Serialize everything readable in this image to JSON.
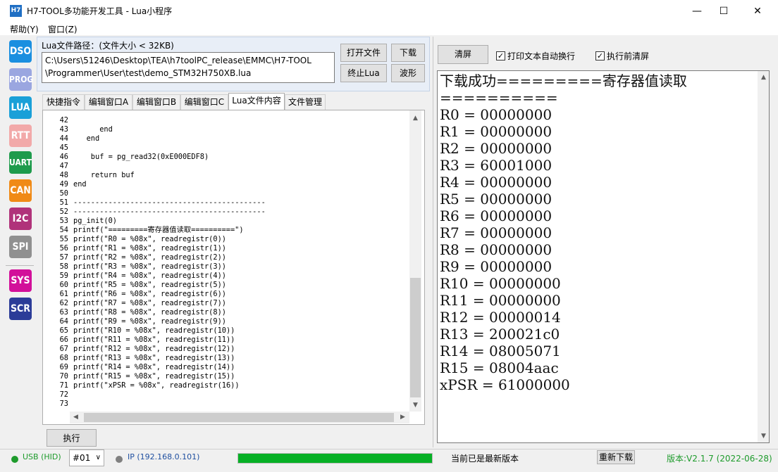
{
  "window": {
    "title": "H7-TOOL多功能开发工具 - Lua小程序",
    "icon_text": "H7"
  },
  "menu": [
    "帮助(Y)",
    "窗口(Z)"
  ],
  "tools": [
    {
      "label": "DSO",
      "color": "#1a8fe0"
    },
    {
      "label": "PROG",
      "color": "#9aa6e0"
    },
    {
      "label": "LUA",
      "color": "#1aa0d8"
    },
    {
      "label": "RTT",
      "color": "#f2a9a9"
    },
    {
      "label": "UART",
      "color": "#1e9b4c"
    },
    {
      "label": "CAN",
      "color": "#f08a16"
    },
    {
      "label": "I2C",
      "color": "#b0327a"
    },
    {
      "label": "SPI",
      "color": "#909090"
    },
    {
      "label": "SYS",
      "color": "#d2109a"
    },
    {
      "label": "SCR",
      "color": "#2b3c98"
    }
  ],
  "lua": {
    "path_label": "Lua文件路径：(文件大小 < 32KB)",
    "path_line1": "C:\\Users\\51246\\Desktop\\TEA\\h7toolPC_release\\EMMC\\H7-TOOL",
    "path_line2": "\\Programmer\\User\\test\\demo_STM32H750XB.lua",
    "buttons": {
      "open": "打开文件",
      "download": "下载",
      "stop": "终止Lua",
      "wave": "波形"
    },
    "tabs": [
      "快捷指令",
      "编辑窗口A",
      "编辑窗口B",
      "编辑窗口C",
      "Lua文件内容",
      "文件管理"
    ],
    "active_tab": 4,
    "run_label": "执行"
  },
  "code_lines": [
    {
      "n": "42",
      "t": ""
    },
    {
      "n": "43",
      "t": "      end"
    },
    {
      "n": "44",
      "t": "   end"
    },
    {
      "n": "45",
      "t": ""
    },
    {
      "n": "46",
      "t": "    buf = pg_read32(0xE000EDF8)"
    },
    {
      "n": "47",
      "t": ""
    },
    {
      "n": "48",
      "t": "    return buf"
    },
    {
      "n": "49",
      "t": "end"
    },
    {
      "n": "50",
      "t": ""
    },
    {
      "n": "51",
      "t": "--------------------------------------------"
    },
    {
      "n": "52",
      "t": "--------------------------------------------"
    },
    {
      "n": "53",
      "t": "pg_init(0)"
    },
    {
      "n": "54",
      "t": "printf(\"=========寄存器值读取==========\")"
    },
    {
      "n": "55",
      "t": "printf(\"R0 = %08x\", readregistr(0))"
    },
    {
      "n": "56",
      "t": "printf(\"R1 = %08x\", readregistr(1))"
    },
    {
      "n": "57",
      "t": "printf(\"R2 = %08x\", readregistr(2))"
    },
    {
      "n": "58",
      "t": "printf(\"R3 = %08x\", readregistr(3))"
    },
    {
      "n": "59",
      "t": "printf(\"R4 = %08x\", readregistr(4))"
    },
    {
      "n": "60",
      "t": "printf(\"R5 = %08x\", readregistr(5))"
    },
    {
      "n": "61",
      "t": "printf(\"R6 = %08x\", readregistr(6))"
    },
    {
      "n": "62",
      "t": "printf(\"R7 = %08x\", readregistr(7))"
    },
    {
      "n": "63",
      "t": "printf(\"R8 = %08x\", readregistr(8))"
    },
    {
      "n": "64",
      "t": "printf(\"R9 = %08x\", readregistr(9))"
    },
    {
      "n": "65",
      "t": "printf(\"R10 = %08x\", readregistr(10))"
    },
    {
      "n": "66",
      "t": "printf(\"R11 = %08x\", readregistr(11))"
    },
    {
      "n": "67",
      "t": "printf(\"R12 = %08x\", readregistr(12))"
    },
    {
      "n": "68",
      "t": "printf(\"R13 = %08x\", readregistr(13))"
    },
    {
      "n": "69",
      "t": "printf(\"R14 = %08x\", readregistr(14))"
    },
    {
      "n": "70",
      "t": "printf(\"R15 = %08x\", readregistr(15))"
    },
    {
      "n": "71",
      "t": "printf(\"xPSR = %08x\", readregistr(16))"
    },
    {
      "n": "72",
      "t": ""
    },
    {
      "n": "73",
      "t": ""
    }
  ],
  "output": {
    "clear_label": "清屏",
    "wrap_label": "打印文本自动换行",
    "clear_before_label": "执行前清屏",
    "lines": [
      "下载成功=========寄存器值读取",
      "==========",
      "R0 = 00000000",
      "R1 = 00000000",
      "R2 = 00000000",
      "R3 = 60001000",
      "R4 = 00000000",
      "R5 = 00000000",
      "R6 = 00000000",
      "R7 = 00000000",
      "R8 = 00000000",
      "R9 = 00000000",
      "R10 = 00000000",
      "R11 = 00000000",
      "R12 = 00000014",
      "R13 = 200021c0",
      "R14 = 08005071",
      "R15 = 08004aac",
      "xPSR = 61000000"
    ]
  },
  "status": {
    "usb": "USB (HID)",
    "device": "#01",
    "ip": "IP (192.168.0.101)",
    "progress": 1.0,
    "latest": "当前已是最新版本",
    "redownload": "重新下载",
    "version": "版本:V2.1.7 (2022-06-28)",
    "green": "#1e9b2c"
  }
}
